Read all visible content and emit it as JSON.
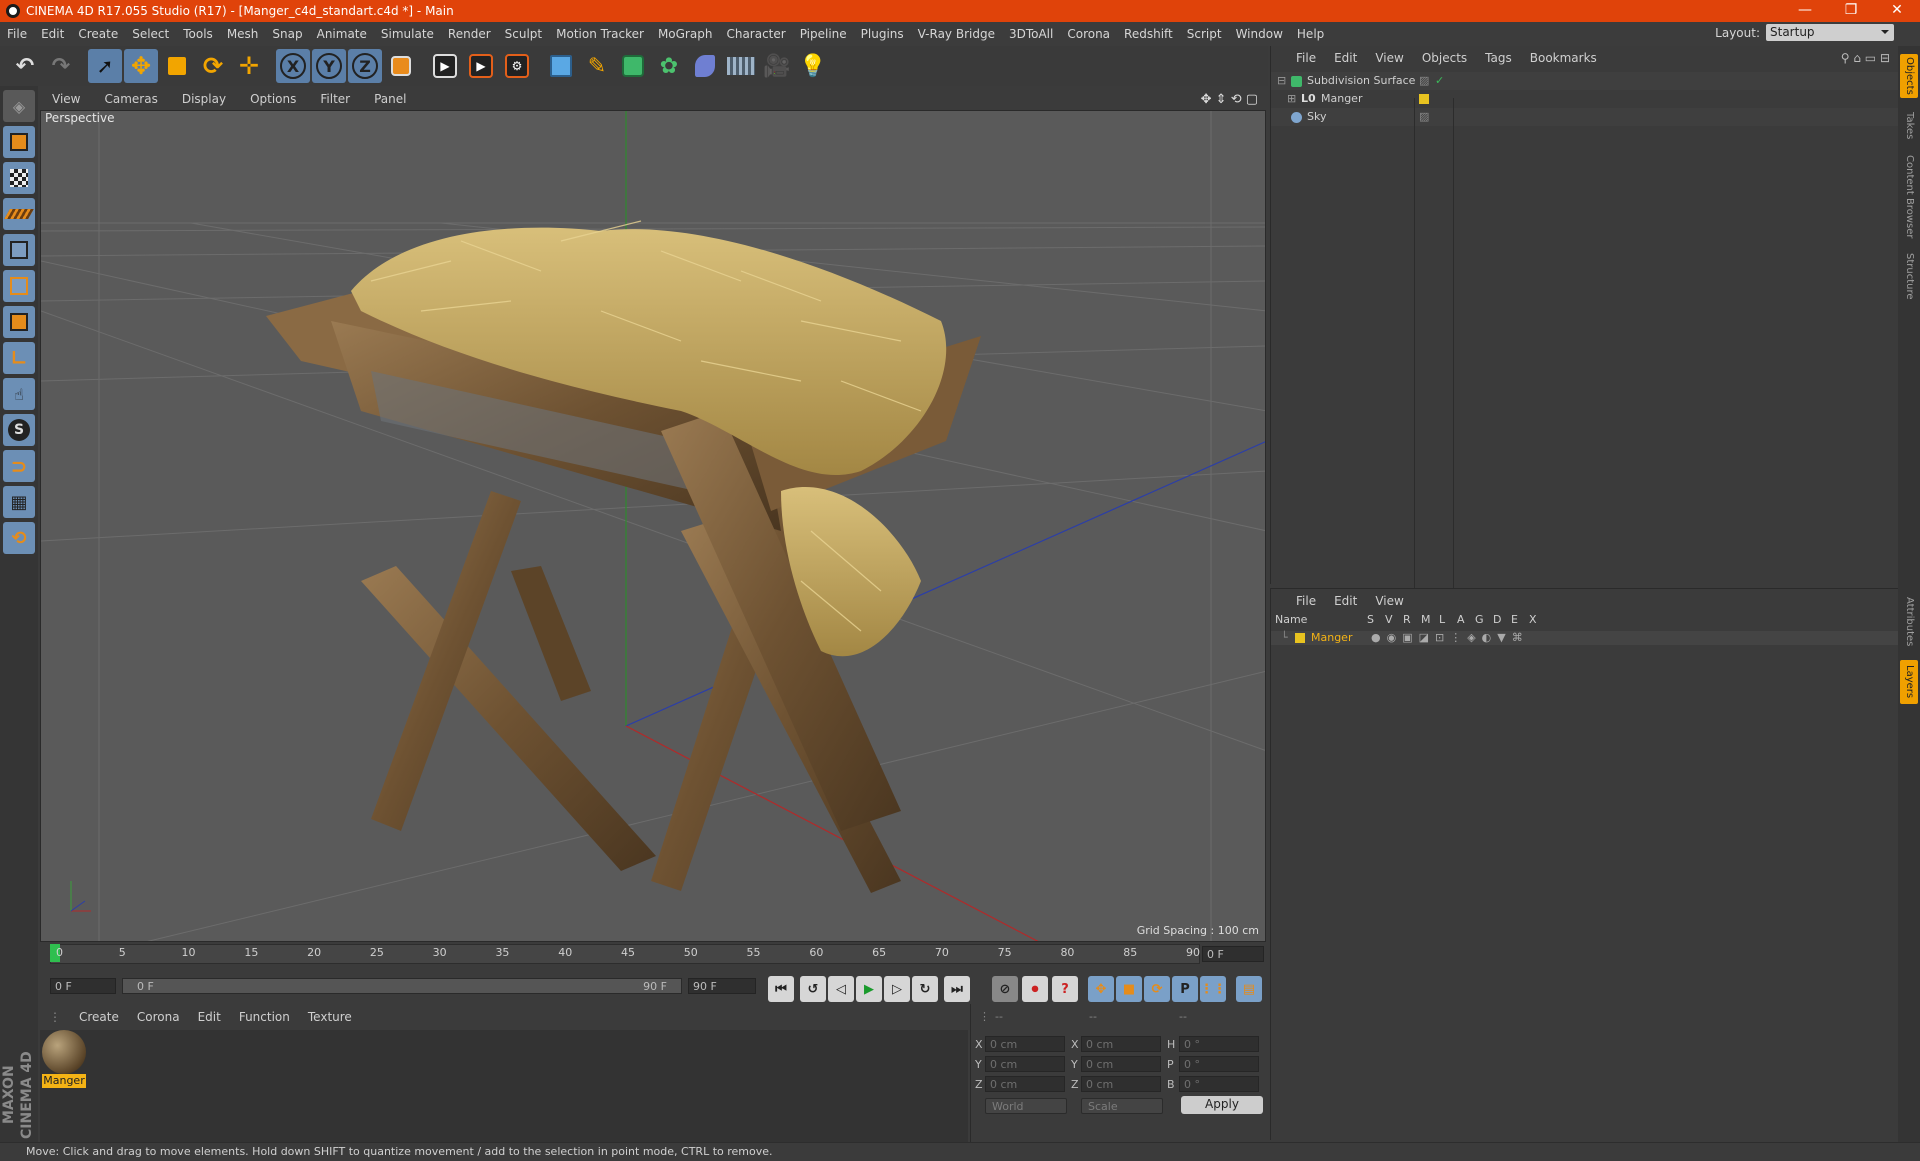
{
  "window": {
    "title": "CINEMA 4D R17.055 Studio (R17) - [Manger_c4d_standart.c4d *] - Main",
    "controls": {
      "minimize": "—",
      "restore": "❐",
      "close": "✕"
    }
  },
  "menubar": [
    "File",
    "Edit",
    "Create",
    "Select",
    "Tools",
    "Mesh",
    "Snap",
    "Animate",
    "Simulate",
    "Render",
    "Sculpt",
    "Motion Tracker",
    "MoGraph",
    "Character",
    "Pipeline",
    "Plugins",
    "V-Ray Bridge",
    "3DToAll",
    "Corona",
    "Redshift",
    "Script",
    "Window",
    "Help"
  ],
  "layout": {
    "label": "Layout:",
    "value": "Startup"
  },
  "toolbar": {
    "icons": [
      "undo-icon",
      "redo-icon",
      "select-arrow-icon",
      "move-icon",
      "scale-icon",
      "rotate-icon",
      "transform-icon",
      "x-axis-icon",
      "y-axis-icon",
      "z-axis-icon",
      "coordinate-system-icon",
      "render-view-icon",
      "render-picture-viewer-icon",
      "render-settings-icon",
      "cube-icon",
      "pen-icon",
      "subdivision-icon",
      "array-icon",
      "deformer-icon",
      "floor-icon",
      "camera-icon",
      "light-icon"
    ],
    "axis_labels": [
      "X",
      "Y",
      "Z"
    ]
  },
  "lefttools": [
    "make-editable-icon",
    "model-mode-icon",
    "texture-mode-icon",
    "workplane-icon",
    "points-mode-icon",
    "edges-mode-icon",
    "polygons-mode-icon",
    "axis-mode-icon",
    "tweak-icon",
    "snap-icon",
    "magnet-icon",
    "lock-workplane-icon",
    "grid-icon"
  ],
  "viewport": {
    "menu": [
      "View",
      "Cameras",
      "Display",
      "Options",
      "Filter",
      "Panel"
    ],
    "label": "Perspective",
    "grid_spacing": "Grid Spacing : 100 cm"
  },
  "timeline": {
    "ticks": [
      "0",
      "5",
      "10",
      "15",
      "20",
      "25",
      "30",
      "35",
      "40",
      "45",
      "50",
      "55",
      "60",
      "65",
      "70",
      "75",
      "80",
      "85",
      "90"
    ],
    "current_frame": "0 F",
    "start_field": "0 F",
    "range_start": "0 F",
    "range_end": "90 F",
    "end_field": "90 F"
  },
  "playback": [
    "go-start-icon",
    "prev-key-icon",
    "prev-frame-icon",
    "play-icon",
    "next-frame-icon",
    "next-key-icon",
    "go-end-icon"
  ],
  "material_panel": {
    "menu": [
      "Create",
      "Corona",
      "Edit",
      "Function",
      "Texture"
    ],
    "materials": [
      {
        "name": "Manger"
      }
    ]
  },
  "coordinates": {
    "headers": [
      "--",
      "--",
      "--"
    ],
    "rows": [
      {
        "a": "X",
        "av": "0 cm",
        "b": "X",
        "bv": "0 cm",
        "c": "H",
        "cv": "0 °"
      },
      {
        "a": "Y",
        "av": "0 cm",
        "b": "Y",
        "bv": "0 cm",
        "c": "P",
        "cv": "0 °"
      },
      {
        "a": "Z",
        "av": "0 cm",
        "b": "Z",
        "bv": "0 cm",
        "c": "B",
        "cv": "0 °"
      }
    ],
    "mode": "World",
    "scale_mode": "Scale",
    "apply": "Apply"
  },
  "objects_panel": {
    "menu": [
      "File",
      "Edit",
      "View",
      "Objects",
      "Tags",
      "Bookmarks"
    ],
    "items": [
      {
        "name": "Subdivision Surface",
        "icon": "subdivision-icon"
      },
      {
        "name": "Manger",
        "icon": "null-object-icon"
      },
      {
        "name": "Sky",
        "icon": "sky-icon"
      }
    ]
  },
  "layers_panel": {
    "menu": [
      "File",
      "Edit",
      "View"
    ],
    "columns": [
      "Name",
      "S",
      "V",
      "R",
      "M",
      "L",
      "A",
      "G",
      "D",
      "E",
      "X"
    ],
    "items": [
      {
        "name": "Manger",
        "color": "#e8c320"
      }
    ]
  },
  "side_tabs": [
    "Objects",
    "Takes",
    "Content Browser",
    "Structure",
    "Attributes",
    "Layers"
  ],
  "status": "Move: Click and drag to move elements. Hold down SHIFT to quantize movement / add to the selection in point mode, CTRL to remove.",
  "branding": "MAXON CINEMA 4D",
  "colors": {
    "title_bar": "#e0430a",
    "accent": "#f4b315",
    "selection": "#5b7fa8"
  }
}
